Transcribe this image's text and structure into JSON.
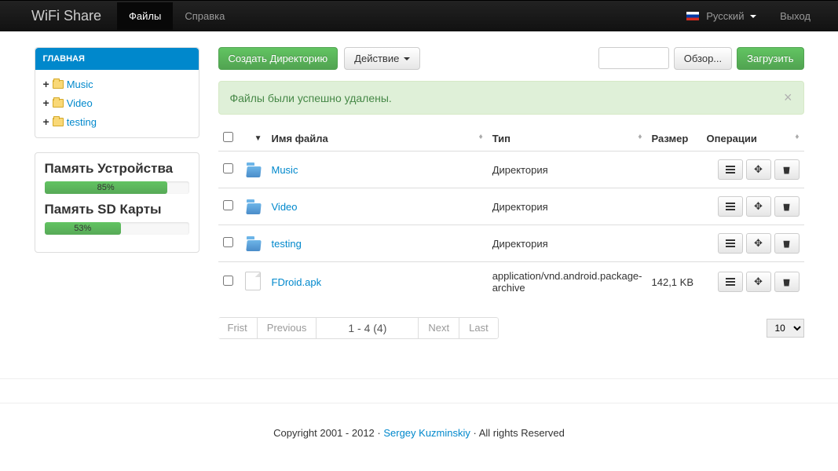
{
  "app_name": "WiFi Share",
  "nav": {
    "files": "Файлы",
    "help": "Справка",
    "language": "Русский",
    "logout": "Выход"
  },
  "sidebar": {
    "main_header": "ГЛАВНАЯ",
    "items": [
      {
        "label": "Music"
      },
      {
        "label": "Video"
      },
      {
        "label": "testing"
      }
    ]
  },
  "memory": {
    "device_label": "Память Устройства",
    "device_pct": "85%",
    "sd_label": "Память SD Карты",
    "sd_pct": "53%"
  },
  "toolbar": {
    "create_dir": "Создать Директорию",
    "action": "Действие",
    "browse": "Обзор...",
    "upload": "Загрузить"
  },
  "alert": {
    "message": "Файлы были успешно удалены."
  },
  "table": {
    "headers": {
      "name": "Имя файла",
      "type": "Тип",
      "size": "Размер",
      "ops": "Операции"
    },
    "rows": [
      {
        "name": "Music",
        "type": "Директория",
        "size": "",
        "kind": "dir"
      },
      {
        "name": "Video",
        "type": "Директория",
        "size": "",
        "kind": "dir"
      },
      {
        "name": "testing",
        "type": "Директория",
        "size": "",
        "kind": "dir"
      },
      {
        "name": "FDroid.apk",
        "type": "application/vnd.android.package-archive",
        "size": "142,1 KB",
        "kind": "file"
      }
    ]
  },
  "pager": {
    "first": "Frist",
    "prev": "Previous",
    "range": "1 - 4 (4)",
    "next": "Next",
    "last": "Last",
    "page_size": "10"
  },
  "footer": {
    "copyright": "Copyright 2001 - 2012 · ",
    "author": "Sergey Kuzminskiy",
    "rights": " · All rights Reserved"
  }
}
